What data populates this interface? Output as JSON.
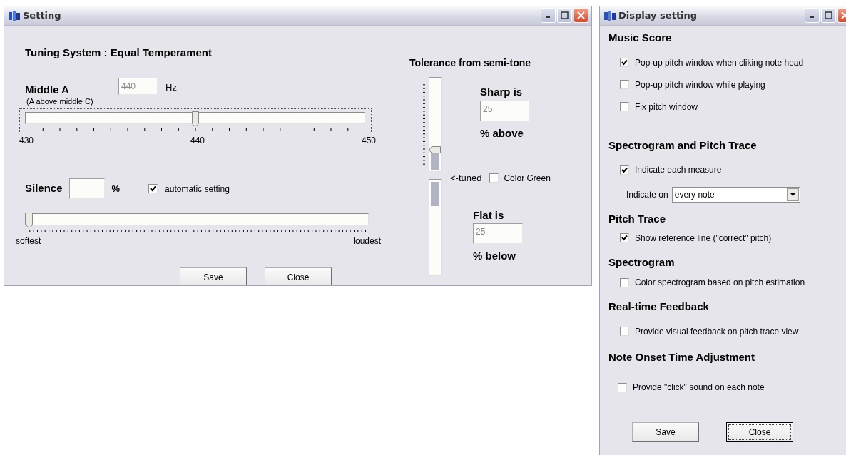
{
  "setting_window": {
    "title": "Setting",
    "tuning_system": "Tuning System : Equal Temperament",
    "middle_a": {
      "label": "Middle A",
      "sublabel": "(A above middle C)",
      "value": "440",
      "unit": "Hz",
      "level": 0.5,
      "tick_labels": [
        "430",
        "440",
        "450"
      ]
    },
    "silence": {
      "label": "Silence",
      "unit": "%",
      "automatic": {
        "label": "automatic setting",
        "checked": true
      },
      "level": 0,
      "min_label": "softest",
      "max_label": "loudest"
    },
    "tolerance": {
      "title": "Tolerance from semi-tone",
      "sharp_slider": {
        "level": 0.25
      },
      "sharp_label": "Sharp is",
      "sharp_value": "25",
      "sharp_unit": "% above",
      "tuned_label": "<-tuned",
      "color_green": {
        "label": "Color Green",
        "checked": false
      },
      "flat_slider": {
        "level": 0.25
      },
      "flat_label": "Flat is",
      "flat_value": "25",
      "flat_unit": "% below"
    },
    "buttons": [
      {
        "label": "Save",
        "focused": false
      },
      {
        "label": "Close",
        "focused": false
      }
    ]
  },
  "display_window": {
    "title": "Display setting",
    "sections": [
      {
        "title": "Music Score",
        "items": [
          {
            "kind": "checkbox",
            "label": "Pop-up pitch window when cliking note head",
            "checked": true
          },
          {
            "kind": "checkbox",
            "label": "Pop-up pitch window while playing",
            "checked": false
          },
          {
            "kind": "checkbox",
            "label": "Fix pitch window",
            "checked": false
          }
        ]
      },
      {
        "title": "Spectrogram and Pitch Trace",
        "items": [
          {
            "kind": "checkbox",
            "label": "Indicate each measure",
            "checked": true
          },
          {
            "kind": "dropdown",
            "label": "Indicate on",
            "value": "every note"
          }
        ]
      },
      {
        "title": "Pitch Trace",
        "items": [
          {
            "kind": "checkbox",
            "label": "Show reference line (\"correct\" pitch)",
            "checked": true
          }
        ]
      },
      {
        "title": "Spectrogram",
        "items": [
          {
            "kind": "checkbox",
            "label": "Color spectrogram based on pitch estimation",
            "checked": false
          }
        ]
      },
      {
        "title": "Real-time Feedback",
        "items": [
          {
            "kind": "checkbox",
            "label": "Provide visual feedback on pitch trace view",
            "checked": false
          }
        ]
      },
      {
        "title": "Note Onset Time Adjustment",
        "items": [
          {
            "kind": "checkbox",
            "label": "Provide \"click\" sound on each note",
            "checked": false
          }
        ]
      }
    ],
    "buttons": [
      {
        "label": "Save",
        "focused": false
      },
      {
        "label": "Close",
        "focused": true
      }
    ]
  }
}
